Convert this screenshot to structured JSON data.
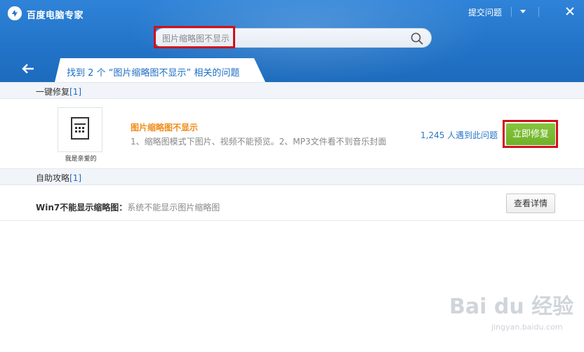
{
  "app": {
    "title": "百度电脑专家",
    "logo_icon": "baidu-expert-logo"
  },
  "topbar": {
    "feedback_label": "提交问题",
    "menu_icon": "▼",
    "close_icon": "✕"
  },
  "search": {
    "value": "图片缩略图不显示",
    "icon": "search-icon"
  },
  "tab": {
    "prefix": "找到 2 个",
    "query_quoted": "“图片缩略图不显示”",
    "suffix": "相关的问题"
  },
  "sections": {
    "one_click": {
      "label": "一键修复",
      "count": "[1]"
    },
    "self_help": {
      "label": "自助攻略",
      "count": "[1]"
    }
  },
  "fix_item": {
    "thumb_caption": "我是亲爱的",
    "title": "图片缩略图不显示",
    "description": "1、缩略图模式下图片、视频不能预览。2、MP3文件看不到音乐封面",
    "count_text": "1,245 人遇到此问题",
    "button_label": "立即修复"
  },
  "guide_item": {
    "title": "Win7不能显示缩略图：",
    "description": "系统不能显示图片缩略图",
    "button_label": "查看详情"
  },
  "watermark": {
    "text": "Bai du 经验",
    "url": "jingyan.baidu.com"
  },
  "colors": {
    "header_blue": "#2274c8",
    "link_blue": "#1b6cc3",
    "orange": "#f08c1a",
    "green_button": "#7bbb33",
    "highlight_red": "#d1101a"
  }
}
